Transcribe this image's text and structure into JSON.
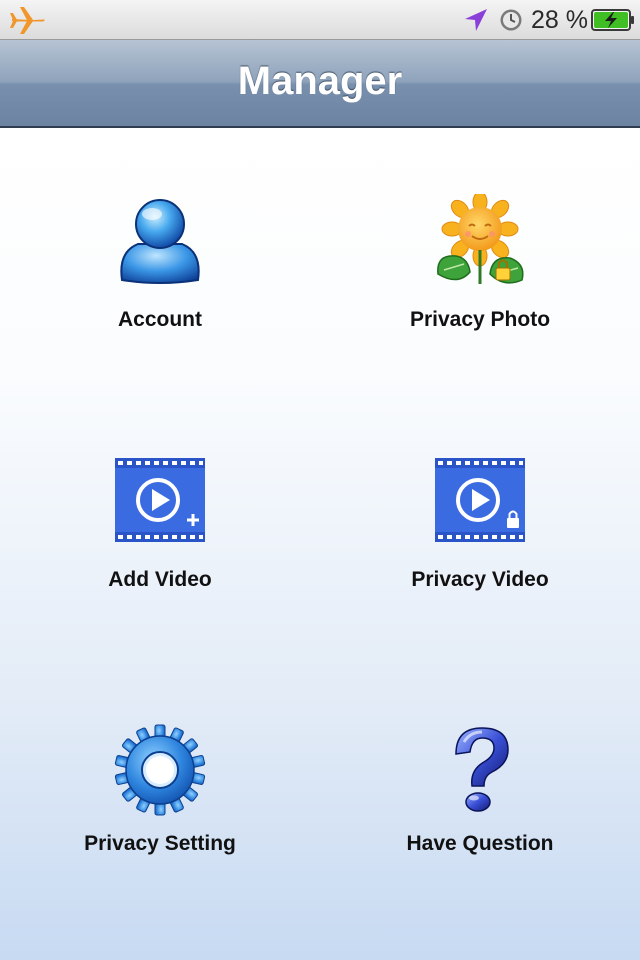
{
  "status_bar": {
    "battery_percent": "28 %",
    "battery_level": 0.28,
    "icons": [
      "airplane-icon",
      "location-arrow-icon",
      "alarm-clock-icon",
      "battery-charging-icon"
    ]
  },
  "nav": {
    "title": "Manager"
  },
  "tiles": [
    {
      "label": "Account",
      "icon": "user-icon"
    },
    {
      "label": "Privacy Photo",
      "icon": "sunflower-lock-icon"
    },
    {
      "label": "Add Video",
      "icon": "video-add-icon"
    },
    {
      "label": "Privacy Video",
      "icon": "video-lock-icon"
    },
    {
      "label": "Privacy Setting",
      "icon": "gear-icon"
    },
    {
      "label": "Have Question",
      "icon": "question-mark-icon"
    }
  ],
  "colors": {
    "nav_gradient_top": "#b6c4d4",
    "nav_gradient_bottom": "#6c84a2",
    "video_icon_blue": "#3b6be0",
    "airplane_orange": "#f0962a",
    "location_purple": "#8b3fd9",
    "battery_green": "#3fbf24"
  }
}
